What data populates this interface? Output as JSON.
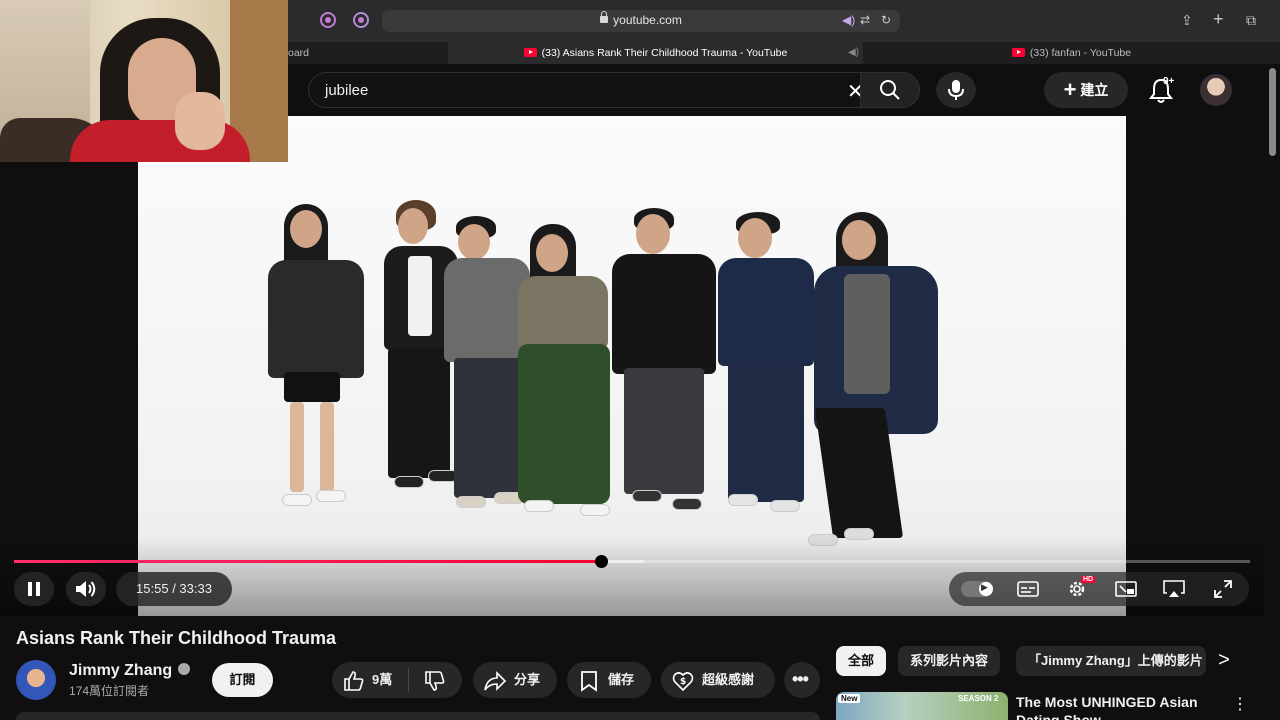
{
  "browser": {
    "url": "youtube.com",
    "tabs": [
      {
        "label": "oard",
        "active": false
      },
      {
        "label": "(33) Asians Rank Their Childhood Trauma - YouTube",
        "active": true
      },
      {
        "label": "(33) fanfan - YouTube",
        "active": false
      }
    ]
  },
  "header": {
    "search_value": "jubilee",
    "create_label": "建立",
    "notifications_badge": "9+"
  },
  "player": {
    "time_display": "15:55 / 33:33",
    "progress_fraction": 0.475,
    "buffer_fraction": 0.51,
    "hd_badge": "HD"
  },
  "video": {
    "title": "Asians Rank Their Childhood Trauma",
    "channel_name": "Jimmy Zhang",
    "subscribers": "174萬位訂閱者",
    "subscribe_label": "訂閱",
    "likes": "9萬",
    "share_label": "分享",
    "save_label": "儲存",
    "thanks_label": "超級感謝"
  },
  "chips": [
    "全部",
    "系列影片內容",
    "「Jimmy Zhang」上傳的影片"
  ],
  "recommended": {
    "new_badge": "New",
    "season_label": "SEASON 2",
    "title": "The Most UNHINGED Asian Dating Show"
  },
  "colors": {
    "accent_red": "#ff0033",
    "background": "#0f0f0f",
    "pill": "#272727"
  }
}
